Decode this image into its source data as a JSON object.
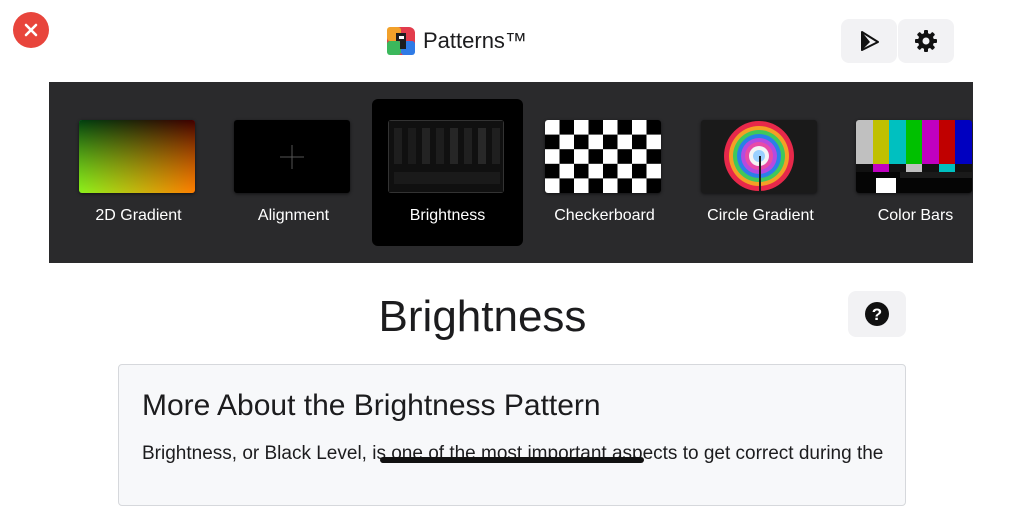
{
  "header": {
    "app_title": "Patterns™",
    "close_icon": "close-icon",
    "cast_icon": "cast-play-icon",
    "settings_icon": "gear-icon"
  },
  "patterns": [
    {
      "label": "2D Gradient",
      "thumb": "2d-gradient",
      "selected": false
    },
    {
      "label": "Alignment",
      "thumb": "alignment",
      "selected": false
    },
    {
      "label": "Brightness",
      "thumb": "brightness",
      "selected": true
    },
    {
      "label": "Checkerboard",
      "thumb": "checkerboard",
      "selected": false
    },
    {
      "label": "Circle Gradient",
      "thumb": "circle-gradient",
      "selected": false
    },
    {
      "label": "Color Bars",
      "thumb": "color-bars",
      "selected": false
    }
  ],
  "main": {
    "title": "Brightness",
    "help_icon": "question-icon",
    "card": {
      "heading": "More About the Brightness Pattern",
      "body": "Brightness, or Black Level, is one of the most important aspects to get correct during the"
    }
  },
  "colors": {
    "close": "#e8453c",
    "strip_bg": "#2a2a2c",
    "selected_tile": "#000000"
  }
}
